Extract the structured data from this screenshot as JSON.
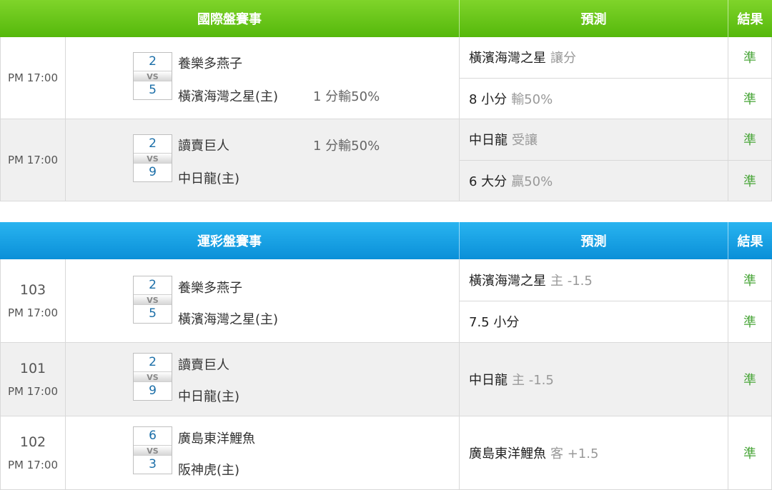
{
  "intl": {
    "header": {
      "event": "國際盤賽事",
      "prediction": "預測",
      "result": "結果"
    },
    "rows": [
      {
        "time": "PM 17:00",
        "away": {
          "score": "2",
          "name": "養樂多燕子",
          "handicap": ""
        },
        "vs": "VS",
        "home": {
          "score": "5",
          "name": "橫濱海灣之星(主)",
          "handicap": "1 分輸50%"
        },
        "predictions": [
          {
            "main": "橫濱海灣之星",
            "detail": "讓分",
            "result": "準"
          },
          {
            "main": "8 小分",
            "detail": "輸50%",
            "result": "準"
          }
        ]
      },
      {
        "time": "PM 17:00",
        "away": {
          "score": "2",
          "name": "讀賣巨人",
          "handicap": "1 分輸50%"
        },
        "vs": "VS",
        "home": {
          "score": "9",
          "name": "中日龍(主)",
          "handicap": ""
        },
        "predictions": [
          {
            "main": "中日龍",
            "detail": "受讓",
            "result": "準"
          },
          {
            "main": "6 大分",
            "detail": "贏50%",
            "result": "準"
          }
        ]
      }
    ]
  },
  "lottery": {
    "header": {
      "event": "運彩盤賽事",
      "prediction": "預測",
      "result": "結果"
    },
    "rows": [
      {
        "num": "103",
        "time": "PM 17:00",
        "away": {
          "score": "2",
          "name": "養樂多燕子"
        },
        "vs": "VS",
        "home": {
          "score": "5",
          "name": "橫濱海灣之星(主)"
        },
        "predictions": [
          {
            "main": "橫濱海灣之星",
            "detail": "主 -1.5",
            "result": "準"
          },
          {
            "main": "7.5 小分",
            "detail": "",
            "result": "準"
          }
        ]
      },
      {
        "num": "101",
        "time": "PM 17:00",
        "away": {
          "score": "2",
          "name": "讀賣巨人"
        },
        "vs": "VS",
        "home": {
          "score": "9",
          "name": "中日龍(主)"
        },
        "predictions": [
          {
            "main": "中日龍",
            "detail": "主 -1.5",
            "result": "準"
          }
        ]
      },
      {
        "num": "102",
        "time": "PM 17:00",
        "away": {
          "score": "6",
          "name": "廣島東洋鯉魚"
        },
        "vs": "VS",
        "home": {
          "score": "3",
          "name": "阪神虎(主)"
        },
        "predictions": [
          {
            "main": "廣島東洋鯉魚",
            "detail": "客 +1.5",
            "result": "準"
          }
        ]
      }
    ]
  },
  "colors": {
    "intl_header": "#6cc71b",
    "lottery_header": "#17a2e6",
    "result_text": "#4aa63a",
    "score_text": "#1a6ea8"
  }
}
